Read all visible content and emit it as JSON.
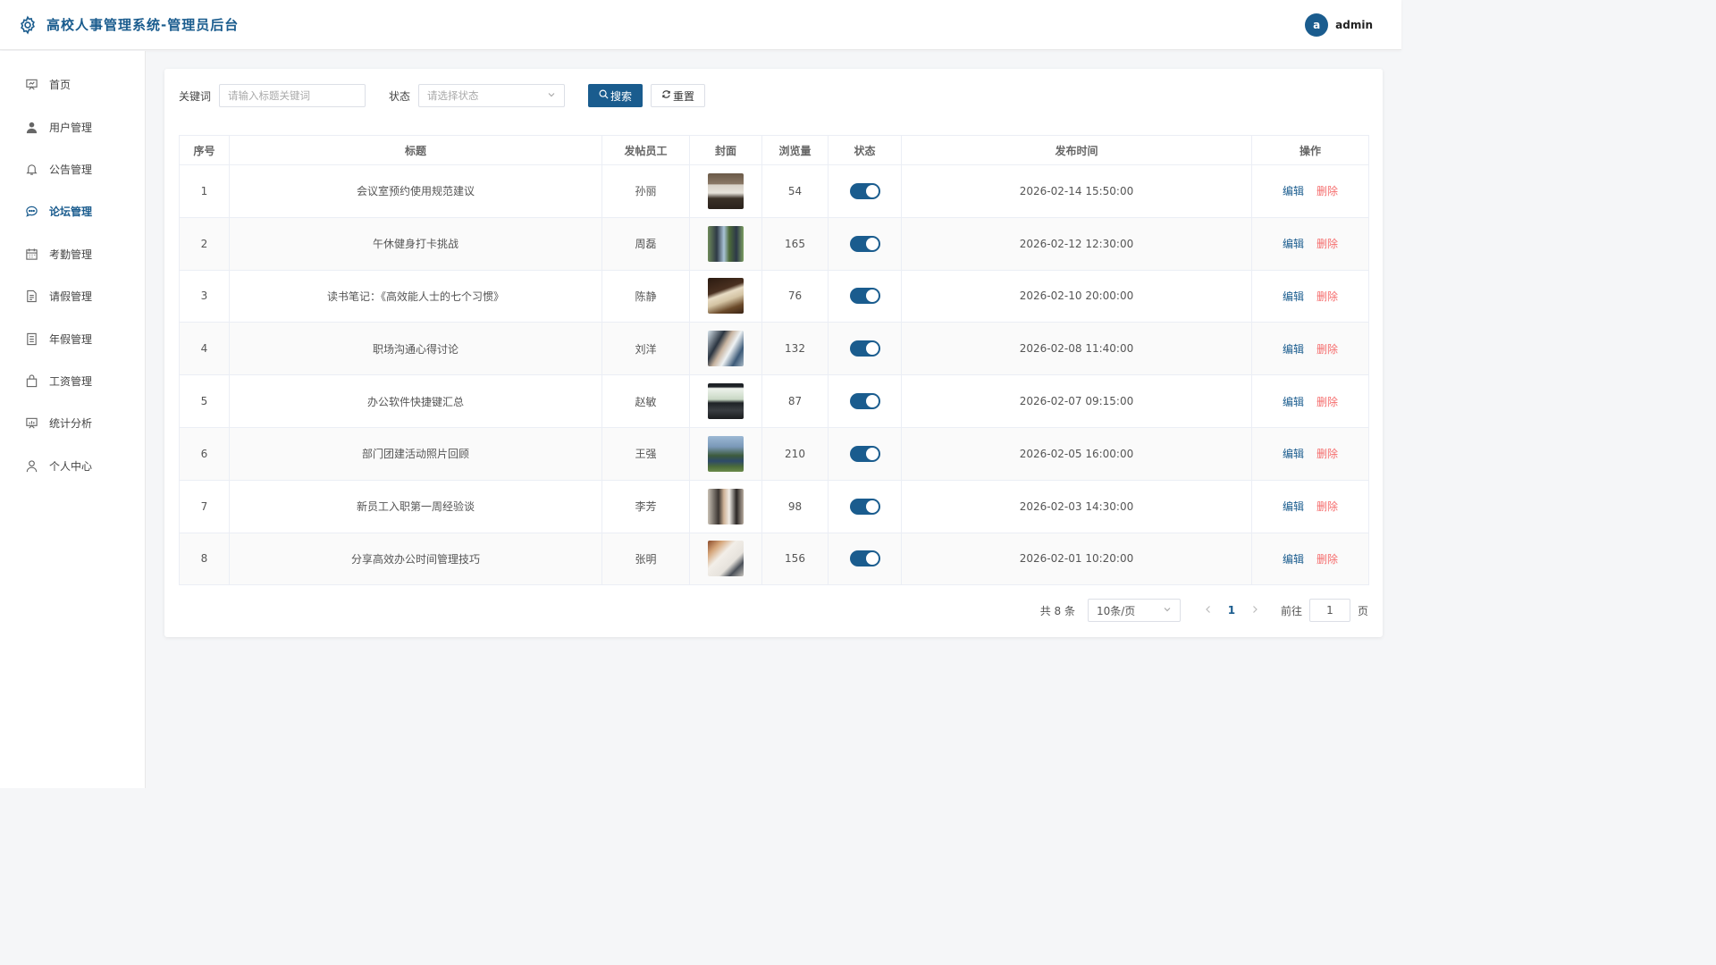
{
  "header": {
    "title": "高校人事管理系统-管理员后台",
    "avatar_letter": "a",
    "user": "admin"
  },
  "sidebar": {
    "items": [
      {
        "label": "首页",
        "icon": "dashboard-icon"
      },
      {
        "label": "用户管理",
        "icon": "user-icon"
      },
      {
        "label": "公告管理",
        "icon": "bell-icon"
      },
      {
        "label": "论坛管理",
        "icon": "chat-icon",
        "active": true
      },
      {
        "label": "考勤管理",
        "icon": "calendar-icon"
      },
      {
        "label": "请假管理",
        "icon": "document-icon"
      },
      {
        "label": "年假管理",
        "icon": "notes-icon"
      },
      {
        "label": "工资管理",
        "icon": "bag-icon"
      },
      {
        "label": "统计分析",
        "icon": "chart-icon"
      },
      {
        "label": "个人中心",
        "icon": "person-icon"
      }
    ]
  },
  "filters": {
    "keyword_label": "关键词",
    "keyword_placeholder": "请输入标题关键词",
    "status_label": "状态",
    "status_placeholder": "请选择状态",
    "search_label": "搜索",
    "reset_label": "重置"
  },
  "table": {
    "headers": [
      "序号",
      "标题",
      "发帖员工",
      "封面",
      "浏览量",
      "状态",
      "发布时间",
      "操作"
    ],
    "edit_label": "编辑",
    "delete_label": "删除",
    "rows": [
      {
        "no": "1",
        "title": "会议室预约使用规范建议",
        "author": "孙丽",
        "views": "54",
        "status": true,
        "time": "2026-02-14 15:50:00"
      },
      {
        "no": "2",
        "title": "午休健身打卡挑战",
        "author": "周磊",
        "views": "165",
        "status": true,
        "time": "2026-02-12 12:30:00"
      },
      {
        "no": "3",
        "title": "读书笔记：《高效能人士的七个习惯》",
        "author": "陈静",
        "views": "76",
        "status": true,
        "time": "2026-02-10 20:00:00"
      },
      {
        "no": "4",
        "title": "职场沟通心得讨论",
        "author": "刘洋",
        "views": "132",
        "status": true,
        "time": "2026-02-08 11:40:00"
      },
      {
        "no": "5",
        "title": "办公软件快捷键汇总",
        "author": "赵敏",
        "views": "87",
        "status": true,
        "time": "2026-02-07 09:15:00"
      },
      {
        "no": "6",
        "title": "部门团建活动照片回顾",
        "author": "王强",
        "views": "210",
        "status": true,
        "time": "2026-02-05 16:00:00"
      },
      {
        "no": "7",
        "title": "新员工入职第一周经验谈",
        "author": "李芳",
        "views": "98",
        "status": true,
        "time": "2026-02-03 14:30:00"
      },
      {
        "no": "8",
        "title": "分享高效办公时间管理技巧",
        "author": "张明",
        "views": "156",
        "status": true,
        "time": "2026-02-01 10:20:00"
      }
    ]
  },
  "pagination": {
    "total": "共 8 条",
    "page_size": "10条/页",
    "current": "1",
    "goto_label": "前往",
    "goto_value": "1",
    "page_unit": "页"
  }
}
